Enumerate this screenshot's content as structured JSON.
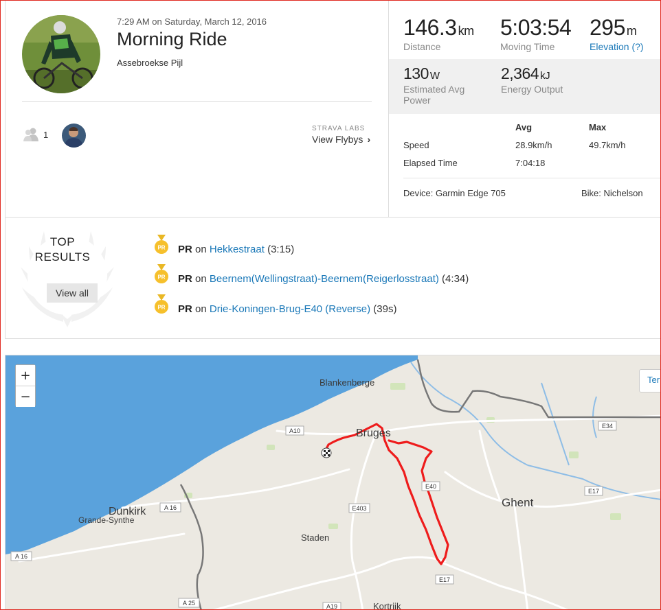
{
  "activity": {
    "timestamp": "7:29 AM on Saturday, March 12, 2016",
    "title": "Morning Ride",
    "description": "Assebroekse Pijl",
    "kudos_count": "1",
    "labs_label": "STRAVA LABS",
    "flybys_label": "View Flybys"
  },
  "stats": {
    "distance": {
      "value": "146.3",
      "unit": "km",
      "label": "Distance"
    },
    "moving_time": {
      "value": "5:03:54",
      "label": "Moving Time"
    },
    "elevation": {
      "value": "295",
      "unit": "m",
      "label": "Elevation (?)"
    },
    "power": {
      "value": "130",
      "unit": "W",
      "label": "Estimated Avg Power"
    },
    "energy": {
      "value": "2,364",
      "unit": "kJ",
      "label": "Energy Output"
    },
    "table": {
      "headers": {
        "avg": "Avg",
        "max": "Max"
      },
      "rows": [
        {
          "label": "Speed",
          "avg": "28.9km/h",
          "max": "49.7km/h"
        },
        {
          "label": "Elapsed Time",
          "avg": "7:04:18",
          "max": ""
        }
      ]
    },
    "device": "Device: Garmin Edge 705",
    "bike": "Bike: Nichelson"
  },
  "top_results": {
    "title": "TOP RESULTS",
    "view_all": "View all",
    "medal_text": "PR",
    "items": [
      {
        "prefix": "PR",
        "on": " on ",
        "segment": "Hekkestraat",
        "time": " (3:15)"
      },
      {
        "prefix": "PR",
        "on": " on ",
        "segment": "Beernem(Wellingstraat)-Beernem(Reigerlosstraat)",
        "time": " (4:34)"
      },
      {
        "prefix": "PR",
        "on": " on ",
        "segment": "Drie-Koningen-Brug-E40 (Reverse)",
        "time": " (39s)"
      }
    ]
  },
  "map": {
    "zoom_in": "+",
    "zoom_out": "−",
    "terrain_label": "Ter",
    "places": {
      "blankenberge": "Blankenberge",
      "bruges": "Bruges",
      "dunkirk": "Dunkirk",
      "grande_synthe": "Grande-Synthe",
      "staden": "Staden",
      "ghent": "Ghent",
      "kortrijk": "Kortrijk"
    },
    "roads": {
      "a10": "A10",
      "e34": "E34",
      "e40": "E40",
      "e17a": "E17",
      "e17b": "E17",
      "e403": "E403",
      "a16a": "A 16",
      "a16b": "A 16",
      "a25": "A 25",
      "a19": "A19"
    },
    "colors": {
      "sea": "#5aa2dc",
      "land": "#ece9e2",
      "route": "#ee1c1c",
      "border": "#777777"
    }
  }
}
